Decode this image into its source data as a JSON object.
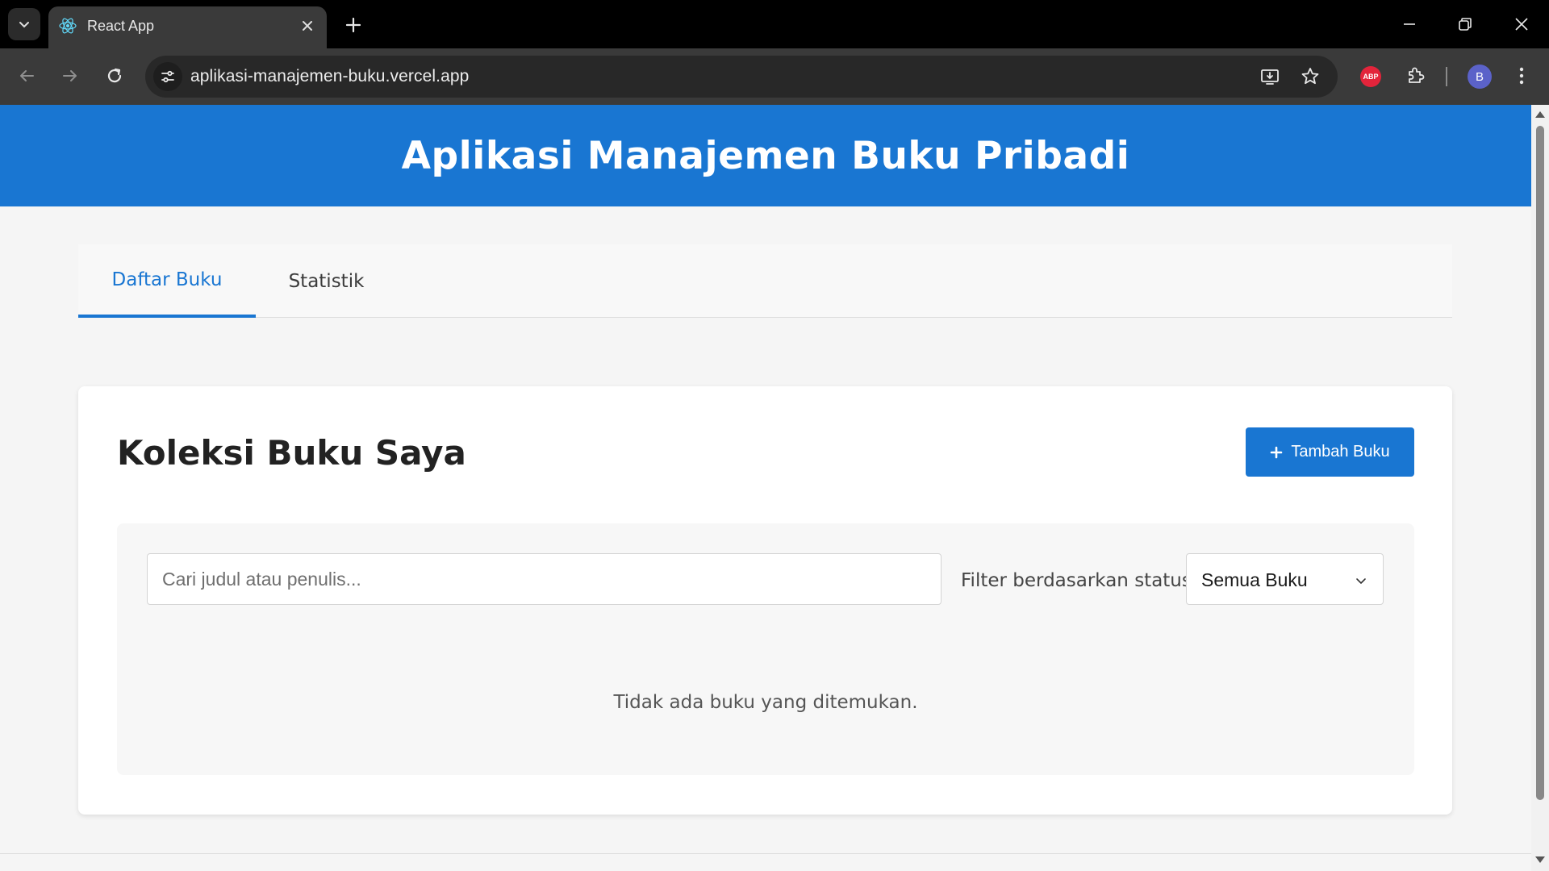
{
  "browser": {
    "tab_title": "React App",
    "url": "aplikasi-manajemen-buku.vercel.app",
    "profile_initial": "B",
    "extension_abp_label": "ABP"
  },
  "app": {
    "title": "Aplikasi Manajemen Buku Pribadi",
    "tabs": [
      {
        "label": "Daftar Buku",
        "active": true
      },
      {
        "label": "Statistik",
        "active": false
      }
    ]
  },
  "collection": {
    "title": "Koleksi Buku Saya",
    "add_button_label": "Tambah Buku",
    "search_placeholder": "Cari judul atau penulis...",
    "filter_label": "Filter berdasarkan status:",
    "filter_selected": "Semua Buku",
    "empty_message": "Tidak ada buku yang ditemukan."
  },
  "colors": {
    "primary": "#1976d2",
    "page_background": "#f5f5f5"
  }
}
